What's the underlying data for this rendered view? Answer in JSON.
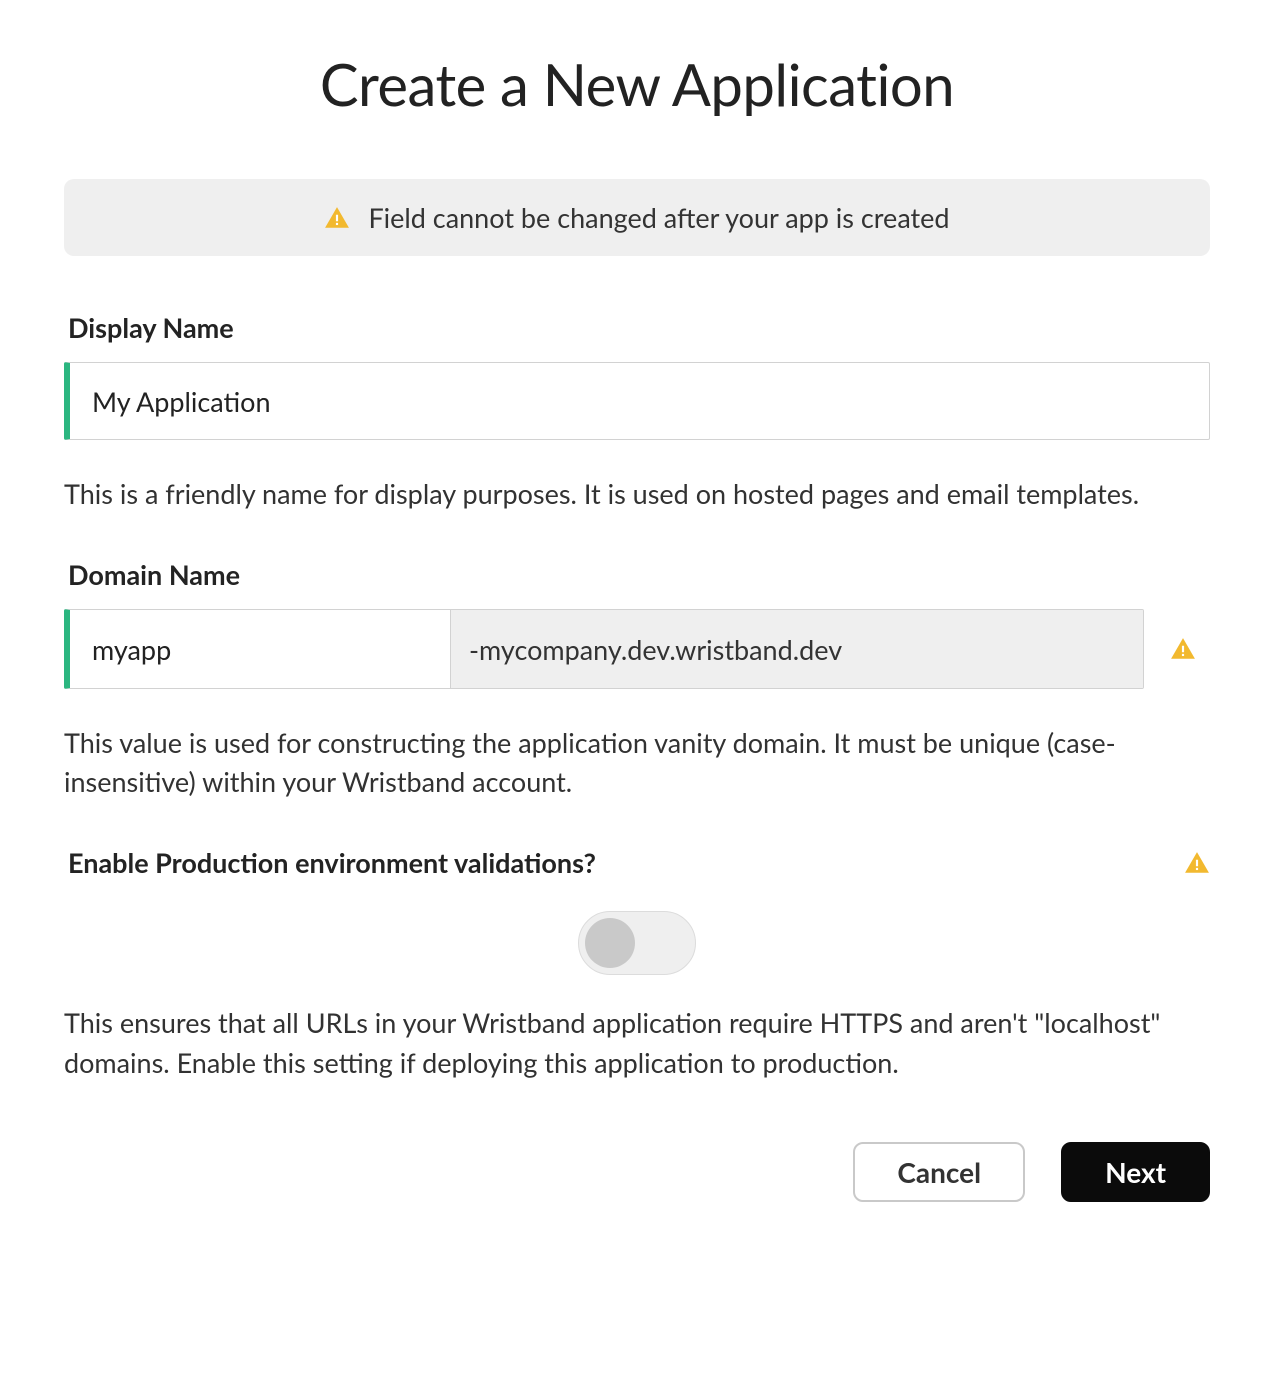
{
  "title": "Create a New Application",
  "banner": {
    "text": "Field cannot be changed after your app is created"
  },
  "fields": {
    "displayName": {
      "label": "Display Name",
      "value": "My Application",
      "helper": "This is a friendly name for display purposes. It is used on hosted pages and email templates."
    },
    "domainName": {
      "label": "Domain Name",
      "value": "myapp",
      "suffix": "-mycompany.dev.wristband.dev",
      "helper": "This value is used for constructing the application vanity domain. It must be unique (case-insensitive) within your Wristband account."
    },
    "prodValidation": {
      "label": "Enable Production environment validations?",
      "enabled": false,
      "helper": "This ensures that all URLs in your Wristband application require HTTPS and aren't \"localhost\" domains. Enable this setting if deploying this application to production."
    }
  },
  "actions": {
    "cancel": "Cancel",
    "next": "Next"
  }
}
